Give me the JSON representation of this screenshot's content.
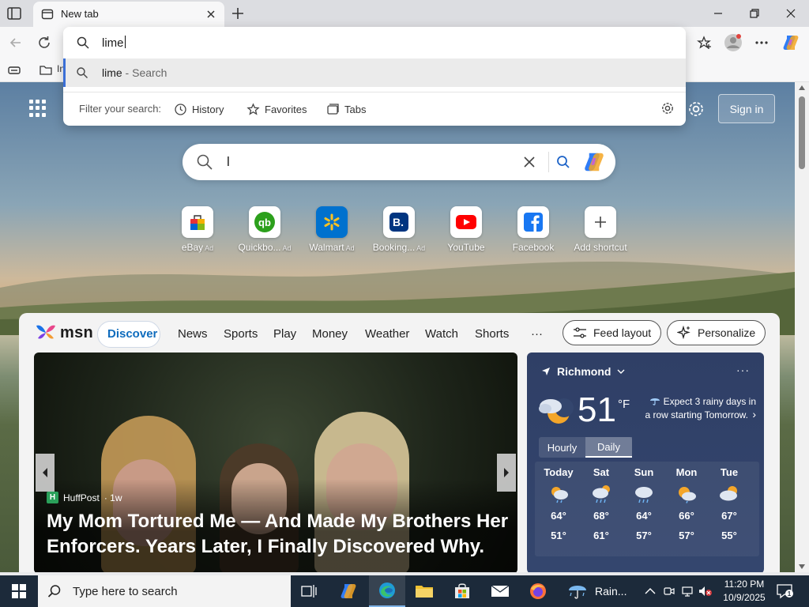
{
  "browser": {
    "tab_title": "New tab",
    "favbar_items": [
      "In"
    ]
  },
  "omnibox": {
    "typed": "lime",
    "suggestion": {
      "term": "lime",
      "sub": " - Search"
    },
    "filter_label": "Filter your search:",
    "filters": [
      "History",
      "Favorites",
      "Tabs"
    ]
  },
  "page": {
    "signin_label": "Sign in",
    "search_value": "l",
    "shortcuts": [
      {
        "label": "eBay",
        "ad": "Ad",
        "icon": "ebay-icon",
        "color": "#e53238"
      },
      {
        "label": "Quickbo...",
        "ad": "Ad",
        "icon": "quickbooks-icon",
        "color": "#2ca01c"
      },
      {
        "label": "Walmart",
        "ad": "Ad",
        "icon": "walmart-icon",
        "color": "#0071ce"
      },
      {
        "label": "Booking...",
        "ad": "Ad",
        "icon": "booking-icon",
        "color": "#003580"
      },
      {
        "label": "YouTube",
        "ad": "",
        "icon": "youtube-icon",
        "color": "#ff0000"
      },
      {
        "label": "Facebook",
        "ad": "",
        "icon": "facebook-icon",
        "color": "#1877f2"
      },
      {
        "label": "Add shortcut",
        "ad": "",
        "icon": "plus-icon",
        "color": "#444444"
      }
    ]
  },
  "feed": {
    "logo_text": "msn",
    "nav": [
      "Discover",
      "News",
      "Sports",
      "Play",
      "Money",
      "Weather",
      "Watch",
      "Shorts"
    ],
    "more": "···",
    "feed_layout": "Feed layout",
    "personalize": "Personalize",
    "hero": {
      "source": "HuffPost",
      "age": "· 1w",
      "source_badge": "H",
      "headline": "My Mom Tortured Me — And Made My Brothers Her Enforcers. Years Later, I Finally Discovered Why."
    }
  },
  "weather": {
    "location": "Richmond",
    "more": "···",
    "temp": "51",
    "unit": "°F",
    "alert": "Expect 3 rainy days in a row starting Tomorrow.",
    "tabs": [
      "Hourly",
      "Daily"
    ],
    "days": [
      {
        "name": "Today",
        "hi": "64°",
        "lo": "51°"
      },
      {
        "name": "Sat",
        "hi": "68°",
        "lo": "61°"
      },
      {
        "name": "Sun",
        "hi": "64°",
        "lo": "57°"
      },
      {
        "name": "Mon",
        "hi": "66°",
        "lo": "57°"
      },
      {
        "name": "Tue",
        "hi": "67°",
        "lo": "55°"
      }
    ]
  },
  "taskbar": {
    "search_placeholder": "Type here to search",
    "weather_label": "Rain...",
    "time": "11:20 PM",
    "date": "10/9/2025"
  },
  "colors": {
    "accent": "#0f6cbd",
    "taskbar": "#1c2a3a"
  }
}
